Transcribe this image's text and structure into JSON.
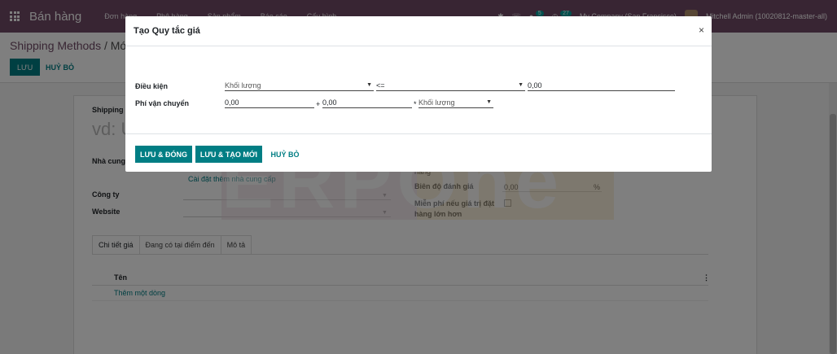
{
  "navbar": {
    "brand": "Bán hàng",
    "menu": [
      "Đơn hàng",
      "Phê hàng",
      "Sản phẩm",
      "Báo cáo",
      "Cấu hình"
    ],
    "badge1": "5",
    "badge2": "27",
    "company": "My Company (San Francisco)",
    "user": "Mitchell Admin (10020812-master-all)"
  },
  "control": {
    "breadcrumb_parent": "Shipping Methods",
    "breadcrumb_sep": " / ",
    "breadcrumb_current": "Mới",
    "save_label": "LƯU",
    "discard_label": "HUỶ BỎ"
  },
  "form": {
    "shipping_label": "Shipping",
    "name_placeholder": "vd: U",
    "provider_label": "Nhà cung",
    "install_more_link": "Cài đặt thêm nhà cung cấp",
    "company_label": "Công ty",
    "website_label": "Website",
    "hang_label": "hàng",
    "margin_label": "Biên độ đánh giá",
    "margin_value": "0,00",
    "margin_unit": "%",
    "free_label": "Miễn phí nếu giá trị đặt hàng lớn hơn"
  },
  "tabs": [
    "Chi tiết giá",
    "Đang có tại điểm đến",
    "Mô tả"
  ],
  "list": {
    "col_name": "Tên",
    "add_line": "Thêm một dòng"
  },
  "watermark": "ERPOne",
  "modal": {
    "title": "Tạo Quy tắc giá",
    "close": "×",
    "condition_label": "Điều kiện",
    "condition_variable": "Khối lượng",
    "condition_operator": "<=",
    "condition_value": "0,00",
    "price_label": "Phí vận chuyển",
    "price_base": "0,00",
    "plus": "+",
    "price_extra": "0,00",
    "times": "*",
    "price_variable": "Khối lượng",
    "save_close": "LƯU & ĐÓNG",
    "save_new": "LƯU & TẠO MỚI",
    "discard": "HUỶ BỎ"
  }
}
